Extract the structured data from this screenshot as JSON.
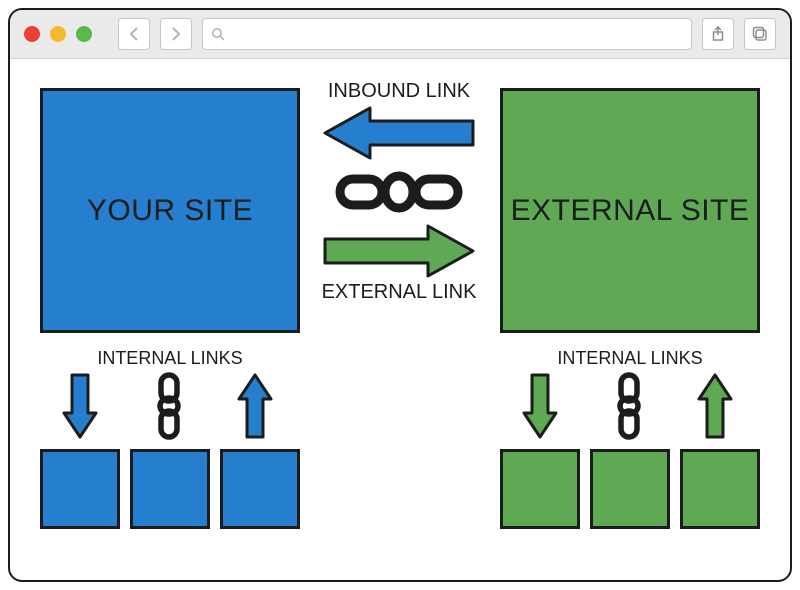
{
  "window": {
    "traffic_lights": [
      "close",
      "minimize",
      "zoom"
    ]
  },
  "diagram": {
    "your_site_label": "YOUR SITE",
    "external_site_label": "EXTERNAL SITE",
    "inbound_label": "INBOUND LINK",
    "external_link_label": "EXTERNAL LINK",
    "internal_links_label_left": "INTERNAL LINKS",
    "internal_links_label_right": "INTERNAL LINKS",
    "colors": {
      "your_site": "#257fce",
      "external_site": "#5fa954",
      "outline": "#1b1c1c"
    }
  }
}
